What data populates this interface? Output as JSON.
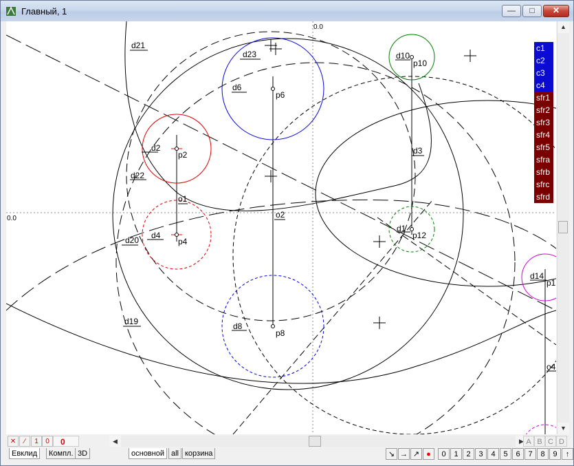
{
  "window": {
    "title": "Главный, 1"
  },
  "canvas": {
    "origin_x_label": "0.0",
    "origin_y_label": "0.0",
    "labels": {
      "d21": "d21",
      "d23": "d23",
      "d6": "d6",
      "d10": "d10",
      "p10": "p10",
      "p6": "p6",
      "d2": "d2",
      "p2": "p2",
      "d22": "d22",
      "d3": "d3",
      "o1": "o1",
      "o2": "o2",
      "d4": "d4",
      "p4": "p4",
      "d20": "d20",
      "d1x": "d1",
      "p12": "p12",
      "d14": "d14",
      "p14": "p1",
      "d19": "d19",
      "d8": "d8",
      "p8": "p8",
      "o4": "o4"
    },
    "colors": {
      "red": "#e00000",
      "blue": "#0000e0",
      "green": "#008000",
      "magenta": "#d000d0",
      "dark": "#000000"
    }
  },
  "curve_list": {
    "items": [
      {
        "label": "c1",
        "color": "#0a0ad0"
      },
      {
        "label": "c2",
        "color": "#0a0ad0"
      },
      {
        "label": "c3",
        "color": "#0a0ad0"
      },
      {
        "label": "c4",
        "color": "#0a0ad0"
      },
      {
        "label": "sfr1",
        "color": "#7a0000"
      },
      {
        "label": "sfr2",
        "color": "#7a0000"
      },
      {
        "label": "sfr3",
        "color": "#7a0000"
      },
      {
        "label": "sfr4",
        "color": "#7a0000"
      },
      {
        "label": "sfr5",
        "color": "#7a0000"
      },
      {
        "label": "sfra",
        "color": "#7a0000"
      },
      {
        "label": "sfrb",
        "color": "#7a0000"
      },
      {
        "label": "sfrc",
        "color": "#7a0000"
      },
      {
        "label": "sfrd",
        "color": "#7a0000"
      }
    ]
  },
  "status": {
    "counter": "0",
    "icon1": "1",
    "icon0": "0"
  },
  "layers": [
    "A",
    "B",
    "C",
    "D"
  ],
  "tabs": {
    "left": [
      "Евклид",
      "Компл.",
      "3D"
    ],
    "pages": [
      "основной",
      "all",
      "корзина"
    ]
  },
  "toolbar_digits": [
    "0",
    "1",
    "2",
    "3",
    "4",
    "5",
    "6",
    "7",
    "8",
    "9"
  ],
  "toolbar_up": "↑"
}
